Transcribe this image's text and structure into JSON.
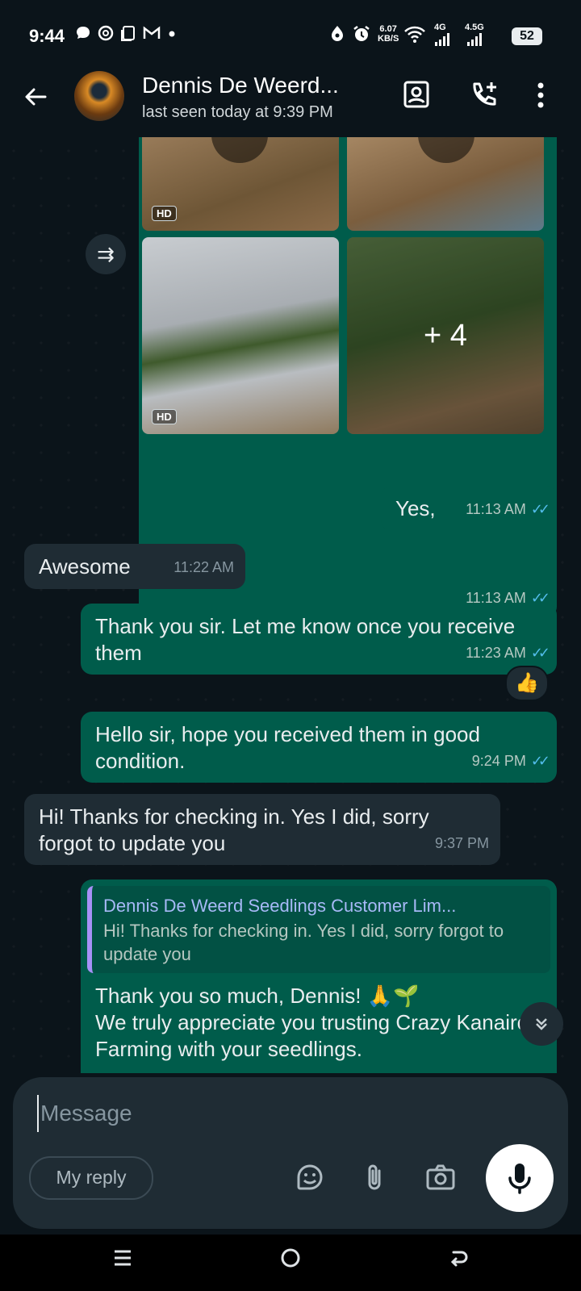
{
  "status_bar": {
    "time": "9:44",
    "network_speed": "6.07",
    "network_speed_unit": "KB/S",
    "signal1": "4G",
    "signal2": "4.5G",
    "battery": "52",
    "icons": [
      "chat-bubble-icon",
      "threads-icon",
      "copy-icon",
      "gmail-icon",
      "dot-icon",
      "drop-icon",
      "alarm-icon",
      "wifi-icon"
    ]
  },
  "header": {
    "contact_name": "Dennis De Weerd...",
    "last_seen": "last seen today at 9:39 PM",
    "icons": [
      "back-arrow-icon",
      "contact-card-icon",
      "add-call-icon",
      "more-vert-icon"
    ]
  },
  "media_message": {
    "hd_label": "HD",
    "more_count": "+ 4",
    "time": "11:13 AM"
  },
  "messages": [
    {
      "id": "m1",
      "direction": "out",
      "text": "Yes,",
      "time": "11:13 AM"
    },
    {
      "id": "m2",
      "direction": "in",
      "text": "Awesome",
      "time": "11:22 AM"
    },
    {
      "id": "m3",
      "direction": "out",
      "text": "Thank you sir. Let me know once you receive them",
      "time": "11:23 AM",
      "reaction": "👍"
    },
    {
      "id": "m4",
      "direction": "out",
      "text": "Hello sir, hope you received them in good condition.",
      "time": "9:24 PM"
    },
    {
      "id": "m5",
      "direction": "in",
      "text": "Hi! Thanks for checking in. Yes I did, sorry forgot to update you",
      "time": "9:37 PM"
    },
    {
      "id": "m6",
      "direction": "out",
      "quote_author": "Dennis De Weerd Seedlings Customer Lim...",
      "quote_text": "Hi! Thanks for checking in. Yes I did, sorry forgot to update you",
      "text_line1": "Thank you so much, Dennis! 🙏🌱",
      "text_line2": "We truly appreciate you trusting Crazy Kanairo Farming with your seedlings."
    }
  ],
  "composer": {
    "placeholder": "Message",
    "my_reply": "My reply"
  },
  "colors": {
    "background": "#0b141a",
    "outgoing_bubble": "#005c4b",
    "incoming_bubble": "#1f2c34",
    "read_ticks": "#53bdeb",
    "quote_bar": "#a791f7"
  }
}
